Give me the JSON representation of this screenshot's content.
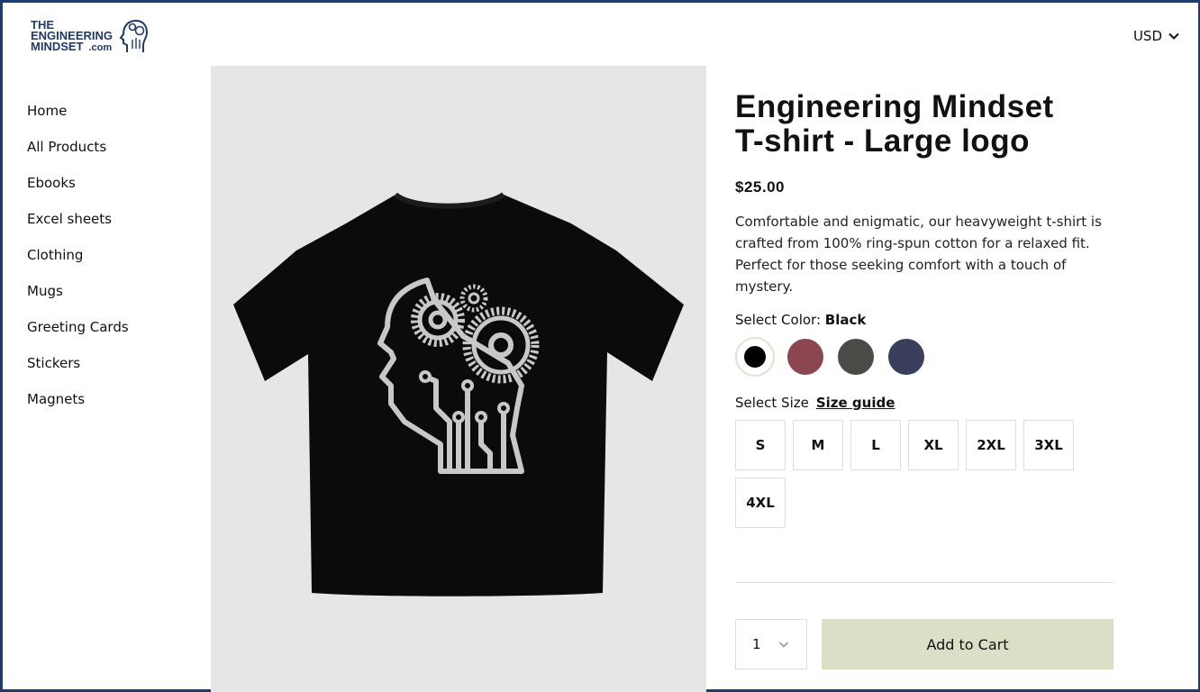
{
  "brand": {
    "logo_line1": "THE",
    "logo_line2": "ENGINEERING",
    "logo_line3": "MINDSET",
    "logo_suffix": ".com",
    "color": "#1f3a6b"
  },
  "header": {
    "currency": "USD"
  },
  "sidebar": {
    "items": [
      {
        "label": "Home"
      },
      {
        "label": "All Products"
      },
      {
        "label": "Ebooks"
      },
      {
        "label": "Excel sheets"
      },
      {
        "label": "Clothing"
      },
      {
        "label": "Mugs"
      },
      {
        "label": "Greeting Cards"
      },
      {
        "label": "Stickers"
      },
      {
        "label": "Magnets"
      }
    ]
  },
  "product": {
    "title_line1": "Engineering Mindset",
    "title_line2": "T-shirt - Large logo",
    "price": "$25.00",
    "description": "Comfortable and enigmatic, our heavyweight t-shirt is crafted from 100% ring-spun cotton for a relaxed fit. Perfect for those seeking comfort with a touch of mystery.",
    "color_label": "Select Color:",
    "selected_color": "Black",
    "colors": [
      {
        "name": "Black",
        "hex": "#000000",
        "selected": true
      },
      {
        "name": "Maroon",
        "hex": "#8c4650",
        "selected": false
      },
      {
        "name": "Charcoal",
        "hex": "#4a4a46",
        "selected": false
      },
      {
        "name": "Navy",
        "hex": "#3a3f5c",
        "selected": false
      }
    ],
    "size_label": "Select Size",
    "size_guide": "Size guide",
    "sizes": [
      "S",
      "M",
      "L",
      "XL",
      "2XL",
      "3XL",
      "4XL"
    ],
    "quantity": "1",
    "add_to_cart": "Add to Cart",
    "cart_button_color": "#dadfc6"
  }
}
